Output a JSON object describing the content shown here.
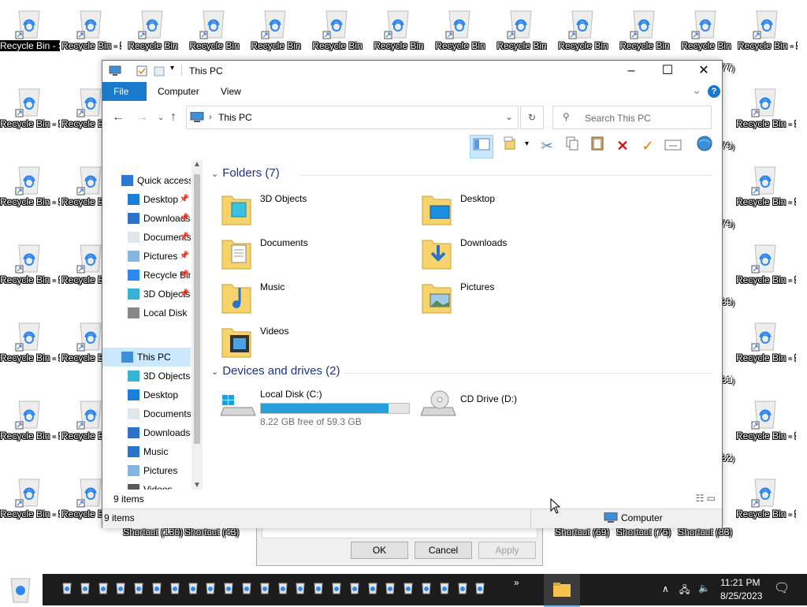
{
  "desktop": {
    "icons": [
      {
        "label": "Recycle Bin - ShShortcut (120)",
        "selected": true
      },
      {
        "label": "Recycle Bin - Shortcut"
      },
      {
        "label": "Recycle Bin"
      },
      {
        "label": "Recycle Bin"
      },
      {
        "label": "Recycle Bin"
      },
      {
        "label": "Recycle Bin"
      },
      {
        "label": "Recycle Bin"
      },
      {
        "label": "Recycle Bin"
      },
      {
        "label": "Recycle Bin"
      },
      {
        "label": "Recycle Bin"
      },
      {
        "label": "Recycle Bin"
      },
      {
        "label": "Recycle Bin"
      },
      {
        "label": "Recycle Bin - Shortcut (84)"
      }
    ],
    "left_col1": [
      "Recycle Bin - Shortcut (30)",
      "Recycle Bin - Shortcut (121)",
      "Recycle Bin - Shortcut (31)",
      "Recycle Bin - Shortcut (122)",
      "Recycle Bin - Shortcut (32)",
      "Recycle Bin - Shortcut (123)"
    ],
    "left_col2": [
      "Recycle Bin - Shortcut",
      "Recycle Bin - Shortcut",
      "Recycle Bin - Shortcut",
      "Recycle Bin - Shortcut",
      "Recycle Bin - Shortcut",
      "Recycle Bin - Shortcut (36)"
    ],
    "right_col": [
      "Recycle Bin - Shortcut (85)",
      "Recycle Bin - Shortcut (86)",
      "Recycle Bin - Shortcut (87)",
      "Recycle Bin - Shortcut (88)",
      "Recycle Bin - Shortcut (89)",
      "Recycle Bin - Shortcut (90)"
    ],
    "partial_right": [
      "77)",
      "79)",
      "79)",
      "89)",
      "81)",
      "82)"
    ],
    "bottom_row": [
      "Shortcut (130)",
      "Shortcut (43)",
      "Shortcut (69)",
      "Shortcut (76)",
      "Shortcut (83)"
    ]
  },
  "dialog": {
    "ok": "OK",
    "cancel": "Cancel",
    "apply": "Apply"
  },
  "window": {
    "title": "This PC",
    "ribbon_tabs": [
      "File",
      "Computer",
      "View"
    ],
    "help": "?",
    "address_crumb": "This PC",
    "search_placeholder": "Search This PC",
    "nav": [
      {
        "label": "Quick access",
        "icon": "star-icon"
      },
      {
        "label": "Desktop",
        "icon": "desktop-icon",
        "pinned": true
      },
      {
        "label": "Downloads",
        "icon": "download-icon",
        "pinned": true
      },
      {
        "label": "Documents",
        "icon": "document-icon",
        "pinned": true
      },
      {
        "label": "Pictures",
        "icon": "pictures-icon",
        "pinned": true
      },
      {
        "label": "Recycle Bin",
        "icon": "recycle-icon",
        "pinned": true
      },
      {
        "label": "3D Objects",
        "icon": "cube-icon",
        "pinned": true
      },
      {
        "label": "Local Disk",
        "icon": "drive-icon"
      },
      {
        "label": "This PC",
        "icon": "computer-icon",
        "selected": true
      },
      {
        "label": "3D Objects",
        "icon": "cube-icon"
      },
      {
        "label": "Desktop",
        "icon": "desktop-icon"
      },
      {
        "label": "Documents",
        "icon": "document-icon"
      },
      {
        "label": "Downloads",
        "icon": "download-icon"
      },
      {
        "label": "Music",
        "icon": "music-icon"
      },
      {
        "label": "Pictures",
        "icon": "pictures-icon"
      },
      {
        "label": "Videos",
        "icon": "video-icon"
      },
      {
        "label": "Local Disk",
        "icon": "drive-icon"
      }
    ],
    "folders_header": "Folders (7)",
    "folders": [
      "3D Objects",
      "Desktop",
      "Documents",
      "Downloads",
      "Music",
      "Pictures",
      "Videos"
    ],
    "devices_header": "Devices and drives (2)",
    "drives": [
      {
        "name": "Local Disk (C:)",
        "free": "8.22 GB free of 59.3 GB",
        "used_fraction": 0.86
      },
      {
        "name": "CD Drive (D:)"
      }
    ],
    "item_count": "9 items",
    "status_count": "9 items",
    "status_location": "Computer"
  },
  "tray": {
    "time": "11:21 PM",
    "date": "8/25/2023"
  },
  "colors": {
    "accent": "#1979ca",
    "selection": "#cce8ff",
    "progress": "#26a0da",
    "taskbar": "#1c1c1c"
  }
}
